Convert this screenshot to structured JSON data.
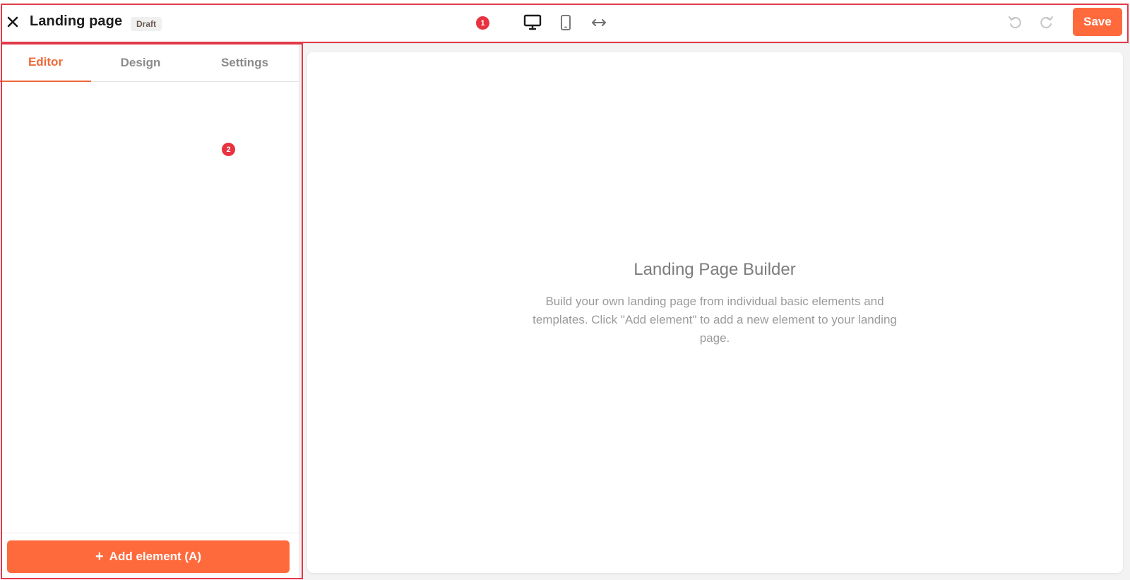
{
  "topbar": {
    "title": "Landing page",
    "status_badge": "Draft",
    "save_label": "Save",
    "icons": {
      "close": "close-icon",
      "desktop": "desktop-icon",
      "mobile": "mobile-icon",
      "full_width": "arrows-horizontal-icon",
      "undo": "undo-icon",
      "redo": "redo-icon"
    }
  },
  "sidebar": {
    "tabs": [
      {
        "label": "Editor",
        "active": true
      },
      {
        "label": "Design",
        "active": false
      },
      {
        "label": "Settings",
        "active": false
      }
    ],
    "add_element_label": "Add element (A)"
  },
  "canvas": {
    "empty_title": "Landing Page Builder",
    "empty_description": "Build your own landing page from individual basic elements and templates. Click \"Add element\" to add a new element to your landing page."
  },
  "annotations": {
    "markers": [
      "1",
      "2"
    ]
  },
  "colors": {
    "accent": "#ff6a3d",
    "annotation": "#e23a4a",
    "muted_text": "#9a9a9a"
  }
}
